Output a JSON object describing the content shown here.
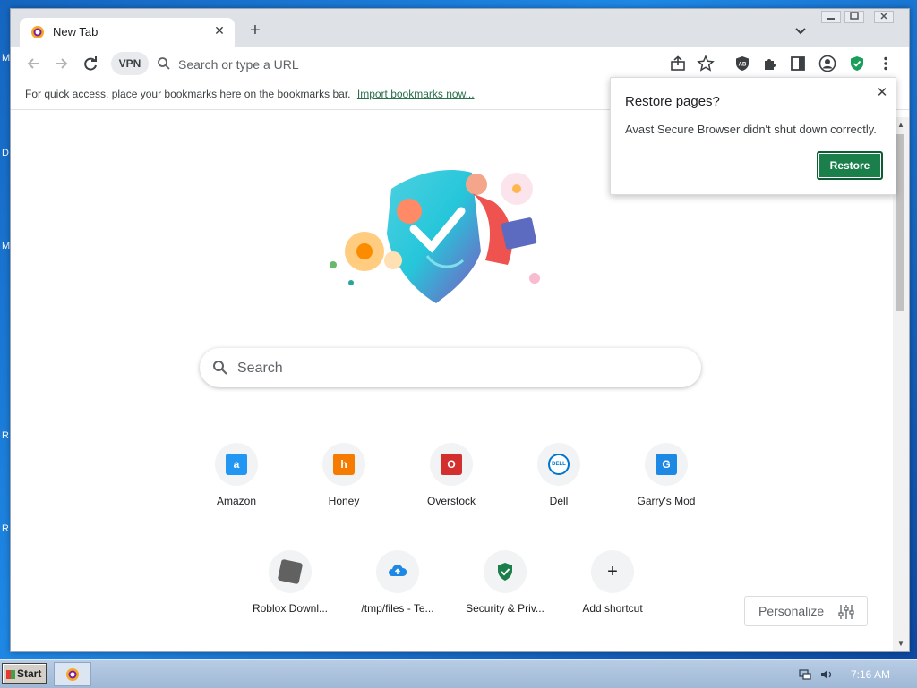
{
  "desktop": {
    "edge_letters": [
      "M",
      "D",
      "M",
      "R",
      "R"
    ]
  },
  "browser": {
    "tab": {
      "title": "New Tab",
      "favicon": "avast-browser-icon"
    },
    "toolbar": {
      "vpn_label": "VPN",
      "omnibox_placeholder": "Search or type a URL",
      "icons": [
        "back-icon",
        "forward-icon",
        "reload-icon",
        "share-icon",
        "star-icon",
        "adblock-icon",
        "extensions-icon",
        "side-panel-icon",
        "profile-icon",
        "avast-shield-icon",
        "menu-icon"
      ]
    },
    "bookmarks_bar": {
      "text": "For quick access, place your bookmarks here on the bookmarks bar.",
      "link": "Import bookmarks now..."
    }
  },
  "newtab": {
    "search_placeholder": "Search",
    "shortcuts": [
      {
        "label": "Amazon",
        "icon": "a",
        "color": "#2196f3"
      },
      {
        "label": "Honey",
        "icon": "h",
        "color": "#f57c00"
      },
      {
        "label": "Overstock",
        "icon": "O",
        "color": "#d32f2f"
      },
      {
        "label": "Dell",
        "icon": "DELL",
        "color": "#0076ce"
      },
      {
        "label": "Garry's Mod",
        "icon": "G",
        "color": "#1e88e5"
      },
      {
        "label": "Roblox Downl...",
        "icon": "R",
        "color": "#616161"
      },
      {
        "label": "/tmp/files - Te...",
        "icon": "cloud",
        "color": "#1e88e5"
      },
      {
        "label": "Security & Priv...",
        "icon": "shield",
        "color": "#1a7f4b"
      },
      {
        "label": "Add shortcut",
        "icon": "+",
        "color": "#202124"
      }
    ],
    "personalize_label": "Personalize"
  },
  "popup": {
    "title": "Restore pages?",
    "message": "Avast Secure Browser didn't shut down correctly.",
    "button": "Restore"
  },
  "taskbar": {
    "start_label": "Start",
    "clock": "7:16 AM"
  }
}
